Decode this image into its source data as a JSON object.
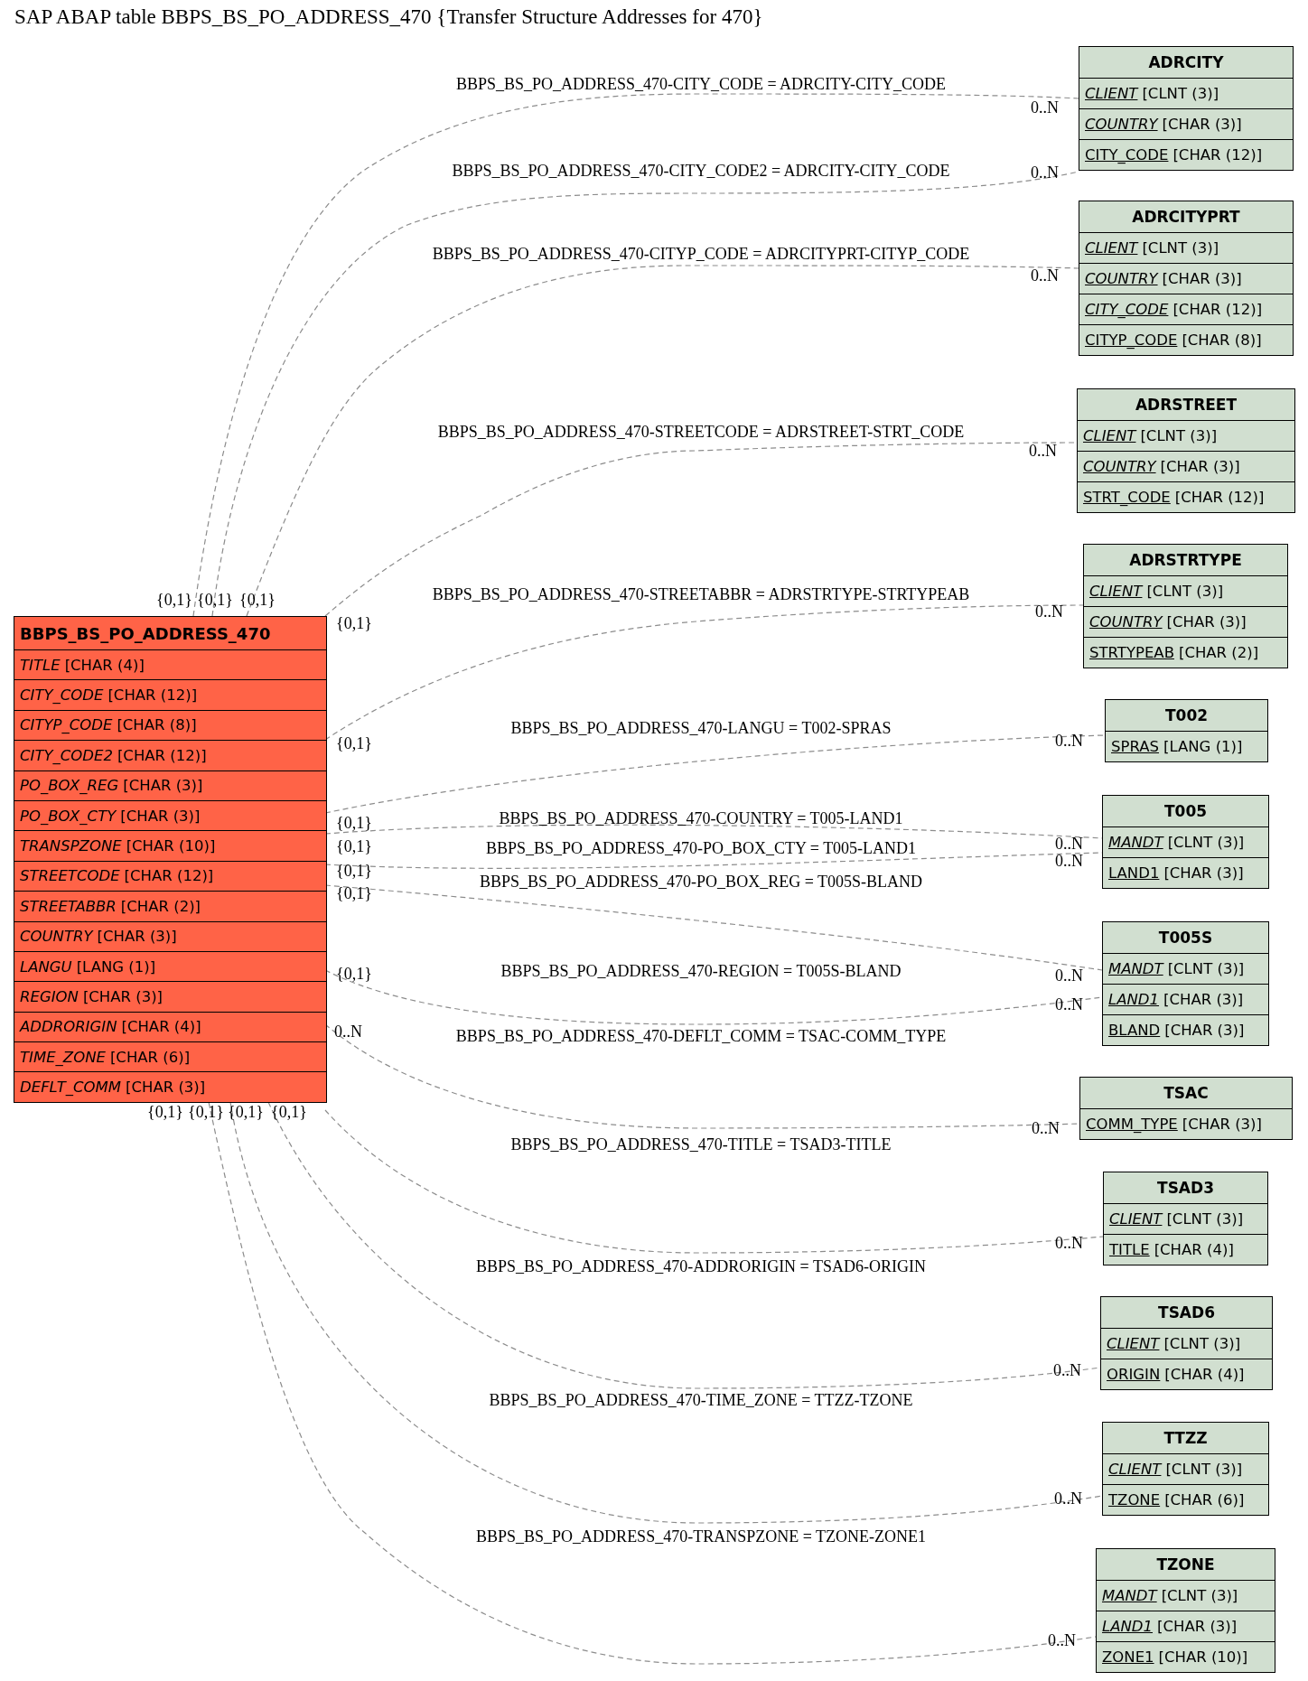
{
  "title": "SAP ABAP table BBPS_BS_PO_ADDRESS_470 {Transfer Structure Addresses for 470}",
  "main_table": {
    "name": "BBPS_BS_PO_ADDRESS_470",
    "fields": [
      {
        "name": "TITLE",
        "type": "[CHAR (4)]",
        "key": false,
        "foreign_key": true
      },
      {
        "name": "CITY_CODE",
        "type": "[CHAR (12)]",
        "key": false,
        "foreign_key": true
      },
      {
        "name": "CITYP_CODE",
        "type": "[CHAR (8)]",
        "key": false,
        "foreign_key": true
      },
      {
        "name": "CITY_CODE2",
        "type": "[CHAR (12)]",
        "key": false,
        "foreign_key": true
      },
      {
        "name": "PO_BOX_REG",
        "type": "[CHAR (3)]",
        "key": false,
        "foreign_key": true
      },
      {
        "name": "PO_BOX_CTY",
        "type": "[CHAR (3)]",
        "key": false,
        "foreign_key": true
      },
      {
        "name": "TRANSPZONE",
        "type": "[CHAR (10)]",
        "key": false,
        "foreign_key": true
      },
      {
        "name": "STREETCODE",
        "type": "[CHAR (12)]",
        "key": false,
        "foreign_key": true
      },
      {
        "name": "STREETABBR",
        "type": "[CHAR (2)]",
        "key": false,
        "foreign_key": true
      },
      {
        "name": "COUNTRY",
        "type": "[CHAR (3)]",
        "key": false,
        "foreign_key": true
      },
      {
        "name": "LANGU",
        "type": "[LANG (1)]",
        "key": false,
        "foreign_key": true
      },
      {
        "name": "REGION",
        "type": "[CHAR (3)]",
        "key": false,
        "foreign_key": true
      },
      {
        "name": "ADDRORIGIN",
        "type": "[CHAR (4)]",
        "key": false,
        "foreign_key": true
      },
      {
        "name": "TIME_ZONE",
        "type": "[CHAR (6)]",
        "key": false,
        "foreign_key": true
      },
      {
        "name": "DEFLT_COMM",
        "type": "[CHAR (3)]",
        "key": false,
        "foreign_key": true
      }
    ]
  },
  "related_tables": [
    {
      "name": "ADRCITY",
      "fields": [
        {
          "name": "CLIENT",
          "type": "[CLNT (3)]",
          "key": true,
          "foreign_key": true
        },
        {
          "name": "COUNTRY",
          "type": "[CHAR (3)]",
          "key": true,
          "foreign_key": true
        },
        {
          "name": "CITY_CODE",
          "type": "[CHAR (12)]",
          "key": true,
          "foreign_key": false
        }
      ]
    },
    {
      "name": "ADRCITYPRT",
      "fields": [
        {
          "name": "CLIENT",
          "type": "[CLNT (3)]",
          "key": true,
          "foreign_key": true
        },
        {
          "name": "COUNTRY",
          "type": "[CHAR (3)]",
          "key": true,
          "foreign_key": true
        },
        {
          "name": "CITY_CODE",
          "type": "[CHAR (12)]",
          "key": true,
          "foreign_key": true
        },
        {
          "name": "CITYP_CODE",
          "type": "[CHAR (8)]",
          "key": true,
          "foreign_key": false
        }
      ]
    },
    {
      "name": "ADRSTREET",
      "fields": [
        {
          "name": "CLIENT",
          "type": "[CLNT (3)]",
          "key": true,
          "foreign_key": true
        },
        {
          "name": "COUNTRY",
          "type": "[CHAR (3)]",
          "key": true,
          "foreign_key": true
        },
        {
          "name": "STRT_CODE",
          "type": "[CHAR (12)]",
          "key": true,
          "foreign_key": false
        }
      ]
    },
    {
      "name": "ADRSTRTYPE",
      "fields": [
        {
          "name": "CLIENT",
          "type": "[CLNT (3)]",
          "key": true,
          "foreign_key": true
        },
        {
          "name": "COUNTRY",
          "type": "[CHAR (3)]",
          "key": true,
          "foreign_key": true
        },
        {
          "name": "STRTYPEAB",
          "type": "[CHAR (2)]",
          "key": true,
          "foreign_key": false
        }
      ]
    },
    {
      "name": "T002",
      "fields": [
        {
          "name": "SPRAS",
          "type": "[LANG (1)]",
          "key": true,
          "foreign_key": false
        }
      ]
    },
    {
      "name": "T005",
      "fields": [
        {
          "name": "MANDT",
          "type": "[CLNT (3)]",
          "key": true,
          "foreign_key": true
        },
        {
          "name": "LAND1",
          "type": "[CHAR (3)]",
          "key": true,
          "foreign_key": false
        }
      ]
    },
    {
      "name": "T005S",
      "fields": [
        {
          "name": "MANDT",
          "type": "[CLNT (3)]",
          "key": true,
          "foreign_key": true
        },
        {
          "name": "LAND1",
          "type": "[CHAR (3)]",
          "key": true,
          "foreign_key": true
        },
        {
          "name": "BLAND",
          "type": "[CHAR (3)]",
          "key": true,
          "foreign_key": false
        }
      ]
    },
    {
      "name": "TSAC",
      "fields": [
        {
          "name": "COMM_TYPE",
          "type": "[CHAR (3)]",
          "key": true,
          "foreign_key": false
        }
      ]
    },
    {
      "name": "TSAD3",
      "fields": [
        {
          "name": "CLIENT",
          "type": "[CLNT (3)]",
          "key": true,
          "foreign_key": true
        },
        {
          "name": "TITLE",
          "type": "[CHAR (4)]",
          "key": true,
          "foreign_key": false
        }
      ]
    },
    {
      "name": "TSAD6",
      "fields": [
        {
          "name": "CLIENT",
          "type": "[CLNT (3)]",
          "key": true,
          "foreign_key": true
        },
        {
          "name": "ORIGIN",
          "type": "[CHAR (4)]",
          "key": true,
          "foreign_key": false
        }
      ]
    },
    {
      "name": "TTZZ",
      "fields": [
        {
          "name": "CLIENT",
          "type": "[CLNT (3)]",
          "key": true,
          "foreign_key": true
        },
        {
          "name": "TZONE",
          "type": "[CHAR (6)]",
          "key": true,
          "foreign_key": false
        }
      ]
    },
    {
      "name": "TZONE",
      "fields": [
        {
          "name": "MANDT",
          "type": "[CLNT (3)]",
          "key": true,
          "foreign_key": true
        },
        {
          "name": "LAND1",
          "type": "[CHAR (3)]",
          "key": true,
          "foreign_key": true
        },
        {
          "name": "ZONE1",
          "type": "[CHAR (10)]",
          "key": true,
          "foreign_key": false
        }
      ]
    }
  ],
  "relations": [
    {
      "label": "BBPS_BS_PO_ADDRESS_470-CITY_CODE = ADRCITY-CITY_CODE",
      "source_cardinality": "{0,1}",
      "target_cardinality": "0..N"
    },
    {
      "label": "BBPS_BS_PO_ADDRESS_470-CITY_CODE2 = ADRCITY-CITY_CODE",
      "source_cardinality": "{0,1}",
      "target_cardinality": "0..N"
    },
    {
      "label": "BBPS_BS_PO_ADDRESS_470-CITYP_CODE = ADRCITYPRT-CITYP_CODE",
      "source_cardinality": "{0,1}",
      "target_cardinality": "0..N"
    },
    {
      "label": "BBPS_BS_PO_ADDRESS_470-STREETCODE = ADRSTREET-STRT_CODE",
      "source_cardinality": "{0,1}",
      "target_cardinality": "0..N"
    },
    {
      "label": "BBPS_BS_PO_ADDRESS_470-STREETABBR = ADRSTRTYPE-STRTYPEAB",
      "source_cardinality": "{0,1}",
      "target_cardinality": "0..N"
    },
    {
      "label": "BBPS_BS_PO_ADDRESS_470-LANGU = T002-SPRAS",
      "source_cardinality": "{0,1}",
      "target_cardinality": "0..N"
    },
    {
      "label": "BBPS_BS_PO_ADDRESS_470-COUNTRY = T005-LAND1",
      "source_cardinality": "{0,1}",
      "target_cardinality": "0..N"
    },
    {
      "label": "BBPS_BS_PO_ADDRESS_470-PO_BOX_CTY = T005-LAND1",
      "source_cardinality": "{0,1}",
      "target_cardinality": "0..N"
    },
    {
      "label": "BBPS_BS_PO_ADDRESS_470-PO_BOX_REG = T005S-BLAND",
      "source_cardinality": "{0,1}",
      "target_cardinality": "0..N"
    },
    {
      "label": "BBPS_BS_PO_ADDRESS_470-REGION = T005S-BLAND",
      "source_cardinality": "{0,1}",
      "target_cardinality": "0..N"
    },
    {
      "label": "BBPS_BS_PO_ADDRESS_470-DEFLT_COMM = TSAC-COMM_TYPE",
      "source_cardinality": "0..N",
      "target_cardinality": "0..N"
    },
    {
      "label": "BBPS_BS_PO_ADDRESS_470-TITLE = TSAD3-TITLE",
      "source_cardinality": "{0,1}",
      "target_cardinality": "0..N"
    },
    {
      "label": "BBPS_BS_PO_ADDRESS_470-ADDRORIGIN = TSAD6-ORIGIN",
      "source_cardinality": "{0,1}",
      "target_cardinality": "0..N"
    },
    {
      "label": "BBPS_BS_PO_ADDRESS_470-TIME_ZONE = TTZZ-TZONE",
      "source_cardinality": "{0,1}",
      "target_cardinality": "0..N"
    },
    {
      "label": "BBPS_BS_PO_ADDRESS_470-TRANSPZONE = TZONE-ZONE1",
      "source_cardinality": "{0,1}",
      "target_cardinality": "0..N"
    }
  ]
}
